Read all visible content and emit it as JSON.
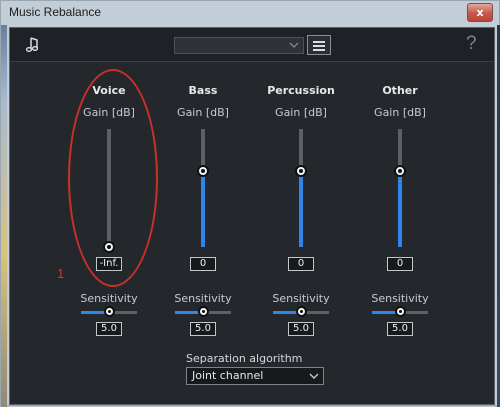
{
  "window": {
    "title": "Music Rebalance",
    "close_glyph": "x"
  },
  "toolbar": {
    "icon": "music-note-icon",
    "preset_value": "",
    "help_label": "?"
  },
  "channels": [
    {
      "name": "Voice",
      "gain_label": "Gain [dB]",
      "gain_value": "-Inf.",
      "gain_level": 0.0,
      "sensitivity_label": "Sensitivity",
      "sensitivity_value": "5.0"
    },
    {
      "name": "Bass",
      "gain_label": "Gain [dB]",
      "gain_value": "0",
      "gain_level": 0.64,
      "sensitivity_label": "Sensitivity",
      "sensitivity_value": "5.0"
    },
    {
      "name": "Percussion",
      "gain_label": "Gain [dB]",
      "gain_value": "0",
      "gain_level": 0.64,
      "sensitivity_label": "Sensitivity",
      "sensitivity_value": "5.0"
    },
    {
      "name": "Other",
      "gain_label": "Gain [dB]",
      "gain_value": "0",
      "gain_level": 0.64,
      "sensitivity_label": "Sensitivity",
      "sensitivity_value": "5.0"
    }
  ],
  "sensitivity_level": 0.5,
  "annotation": {
    "number": "1"
  },
  "separation": {
    "label": "Separation algorithm",
    "value": "Joint channel"
  },
  "colors": {
    "accent": "#2f86e8",
    "annotation": "#c8302a",
    "panel": "#24282c"
  }
}
